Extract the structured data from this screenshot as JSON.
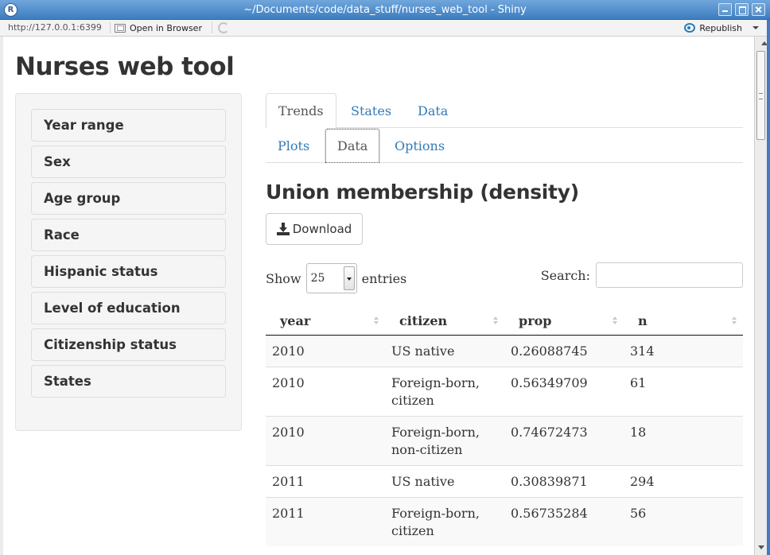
{
  "window": {
    "title": "~/Documents/code/data_stuff/nurses_web_tool - Shiny",
    "app_icon": "R"
  },
  "toolbar": {
    "url": "http://127.0.0.1:6399",
    "open_in_browser": "Open in Browser",
    "republish": "Republish"
  },
  "page": {
    "title": "Nurses web tool"
  },
  "sidebar": {
    "panels": [
      "Year range",
      "Sex",
      "Age group",
      "Race",
      "Hispanic status",
      "Level of education",
      "Citizenship status",
      "States"
    ]
  },
  "tabs_top": [
    "Trends",
    "States",
    "Data"
  ],
  "tabs_sub": [
    "Plots",
    "Data",
    "Options"
  ],
  "content": {
    "section_title": "Union membership (density)",
    "download_label": "Download",
    "show_label": "Show",
    "entries_value": "25",
    "entries_label": "entries",
    "search_label": "Search:",
    "search_value": ""
  },
  "table": {
    "columns": [
      "year",
      "citizen",
      "prop",
      "n"
    ],
    "rows": [
      [
        "2010",
        "US native",
        "0.26088745",
        "314"
      ],
      [
        "2010",
        "Foreign-born, citizen",
        "0.56349709",
        "61"
      ],
      [
        "2010",
        "Foreign-born, non-citizen",
        "0.74672473",
        "18"
      ],
      [
        "2011",
        "US native",
        "0.30839871",
        "294"
      ],
      [
        "2011",
        "Foreign-born, citizen",
        "0.56735284",
        "56"
      ]
    ]
  },
  "colors": {
    "link": "#337ab7",
    "titlebar": "#3d7dc0"
  }
}
